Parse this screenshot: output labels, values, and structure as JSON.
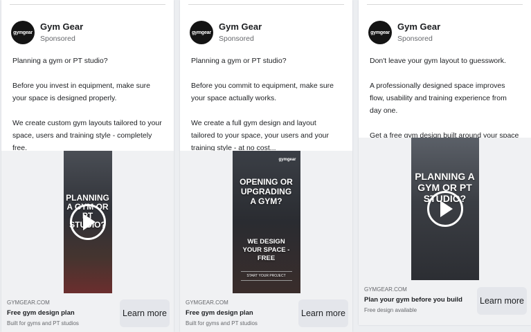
{
  "ads": [
    {
      "page_name": "Gym Gear",
      "sponsored": "Sponsored",
      "avatar_text": "gymgear",
      "body": [
        "Planning a gym or PT studio?",
        "Before you invest in equipment, make sure your space is designed properly.",
        "We create custom gym layouts tailored to your space, users and training style - completely free."
      ],
      "video_overlay": "PLANNING A GYM OR PT STUDIO?",
      "domain": "GYMGEAR.COM",
      "headline": "Free gym design plan",
      "description": "Built for gyms and PT studios",
      "cta": "Learn more"
    },
    {
      "page_name": "Gym Gear",
      "sponsored": "Sponsored",
      "avatar_text": "gymgear",
      "body": [
        "Planning a gym or PT studio?",
        "Before you commit to equipment, make sure your space actually works.",
        "We create a full gym design and layout tailored to your space, your users and your training style - at no cost..."
      ],
      "creative_brand": "gymgear",
      "creative_headline": "OPENING OR UPGRADING A GYM?",
      "creative_sub": "WE DESIGN YOUR SPACE - FREE",
      "creative_cta": "START YOUR PROJECT",
      "domain": "GYMGEAR.COM",
      "headline": "Free gym design plan",
      "description": "Built for gyms and PT studios",
      "cta": "Learn more"
    },
    {
      "page_name": "Gym Gear",
      "sponsored": "Sponsored",
      "avatar_text": "gymgear",
      "body": [
        "Don't leave your gym layout to guesswork.",
        "A professionally designed space improves flow, usability and training experience from day one.",
        "Get a free gym design built around your space and goals."
      ],
      "video_overlay": "PLANNING A GYM OR PT STUDIO?",
      "domain": "GYMGEAR.COM",
      "headline": "Plan your gym before you build",
      "description": "Free design available",
      "cta": "Learn more"
    }
  ]
}
